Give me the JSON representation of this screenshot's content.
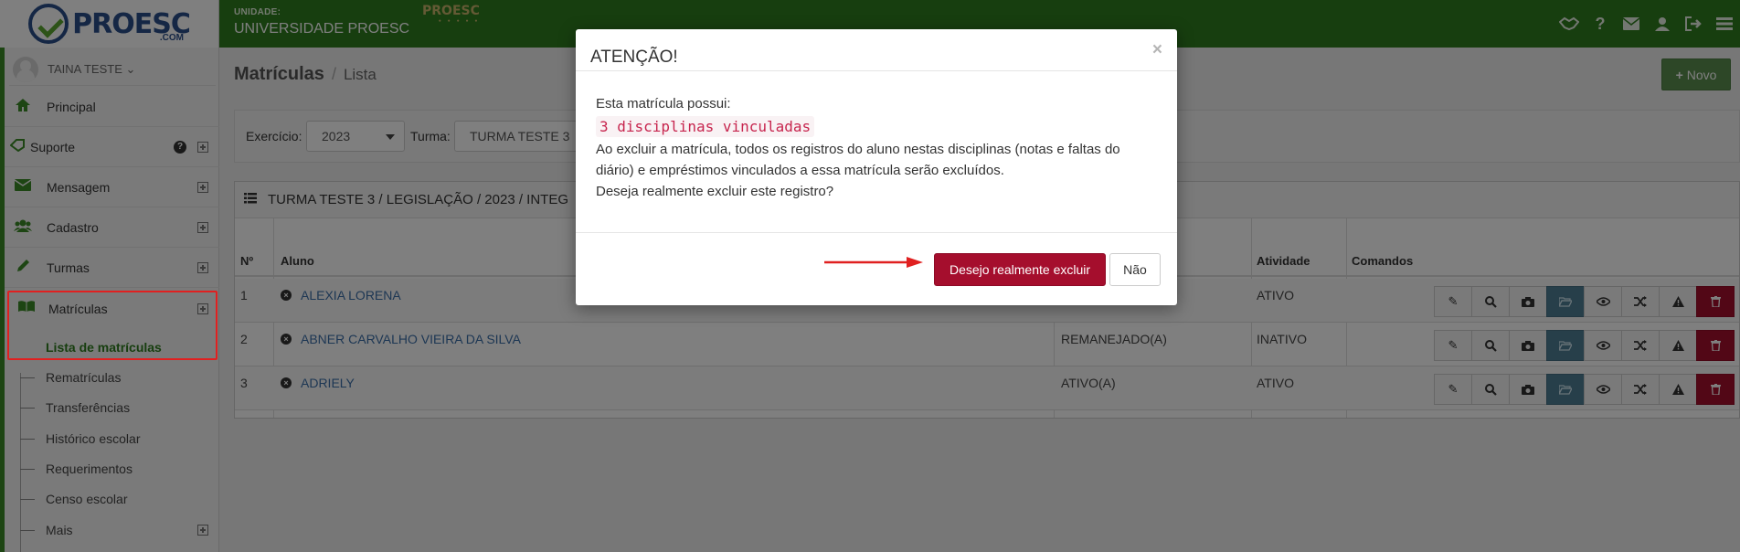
{
  "header": {
    "logo_text": "PROESC",
    "logo_sub": ".COM",
    "unit_label": "UNIDADE:",
    "unit_name": "UNIVERSIDADE PROESC",
    "mini_logo": "PROESC",
    "icons": [
      "handshake-icon",
      "help-icon",
      "envelope-icon",
      "user-icon",
      "logout-icon",
      "hamburger-menu-icon"
    ]
  },
  "sidebar": {
    "user_name": "TAINA TESTE ⌄",
    "items": [
      {
        "label": "Principal",
        "icon": "home-icon"
      },
      {
        "label": "Suporte",
        "icon": "ticket-icon"
      },
      {
        "label": "Mensagem",
        "icon": "envelope-icon"
      },
      {
        "label": "Cadastro",
        "icon": "users-icon"
      },
      {
        "label": "Turmas",
        "icon": "pencil-icon"
      },
      {
        "label": "Matrículas",
        "icon": "book-icon"
      }
    ],
    "sub_items": [
      {
        "label": "Lista de matrículas"
      },
      {
        "label": "Rematrículas"
      },
      {
        "label": "Transferências"
      },
      {
        "label": "Histórico escolar"
      },
      {
        "label": "Requerimentos"
      },
      {
        "label": "Censo escolar"
      },
      {
        "label": "Mais"
      }
    ]
  },
  "page": {
    "title": "Matrículas",
    "breadcrumb": "Lista",
    "new_button": "Novo"
  },
  "filters": {
    "exercicio_label": "Exercício:",
    "exercicio_value": "2023",
    "turma_label": "Turma:",
    "turma_value": "TURMA TESTE 3"
  },
  "table": {
    "panel_title": "TURMA TESTE 3 / LEGISLAÇÃO / 2023 / INTEG",
    "columns": {
      "num": "Nº",
      "aluno": "Aluno",
      "atividade": "Atividade",
      "comandos": "Comandos"
    },
    "rows": [
      {
        "num": "1",
        "aluno": "ALEXIA LORENA",
        "situacao": "",
        "atividade": "ATIVO"
      },
      {
        "num": "2",
        "aluno": "ABNER CARVALHO VIEIRA DA SILVA",
        "situacao": "REMANEJADO(A)",
        "atividade": "INATIVO"
      },
      {
        "num": "3",
        "aluno": "ADRIELY",
        "situacao": "ATIVO(A)",
        "atividade": "ATIVO"
      }
    ],
    "command_icons": [
      "edit-icon",
      "search-icon",
      "camera-icon",
      "folder-open-icon",
      "eye-icon",
      "shuffle-icon",
      "warning-icon",
      "trash-icon"
    ]
  },
  "modal": {
    "title": "ATENÇÃO!",
    "close": "×",
    "line1": "Esta matrícula possui:",
    "code": "3 disciplinas vinculadas",
    "line2": "Ao excluir a matrícula, todos os registros do aluno nestas disciplinas (notas e faltas do diário) e empréstimos vinculados a essa matrícula serão excluídos.",
    "line3": "Deseja realmente excluir este registro?",
    "confirm_button": "Desejo realmente excluir",
    "cancel_button": "Não"
  },
  "colors": {
    "header_green": "#2e7d1f",
    "danger": "#a50e2d",
    "annotation_red": "#e02020"
  }
}
